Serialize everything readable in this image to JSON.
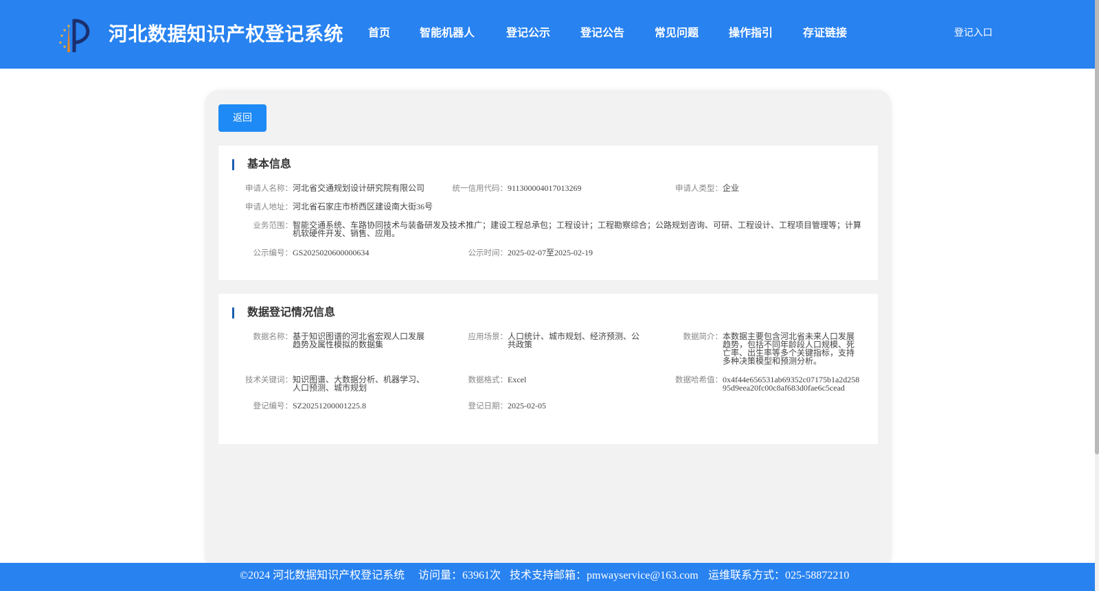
{
  "header": {
    "title": "河北数据知识产权登记系统",
    "nav": [
      "首页",
      "智能机器人",
      "登记公示",
      "登记公告",
      "常见问题",
      "操作指引",
      "存证链接"
    ],
    "login": "登记入口"
  },
  "back_label": "返回",
  "basic": {
    "title": "基本信息",
    "applicant_name": {
      "label": "申请人名称：",
      "value": "河北省交通规划设计研究院有限公司"
    },
    "credit_code": {
      "label": "统一信用代码：",
      "value": "911300004017013269"
    },
    "applicant_type": {
      "label": "申请人类型：",
      "value": "企业"
    },
    "address": {
      "label": "申请人地址：",
      "value": "河北省石家庄市桥西区建设南大街36号"
    },
    "scope": {
      "label": "业务范围：",
      "value": "智能交通系统、车路协同技术与装备研发及技术推广；建设工程总承包；工程设计；工程勘察综合；公路规划咨询、可研、工程设计、工程项目管理等；计算机软硬件开发、销售、应用。"
    },
    "notice_no": {
      "label": "公示编号：",
      "value": "GS2025020600000634"
    },
    "notice_time": {
      "label": "公示时间：",
      "value": "2025-02-07至2025-02-19"
    }
  },
  "data": {
    "title": "数据登记情况信息",
    "name": {
      "label": "数据名称：",
      "value": "基于知识图谱的河北省宏观人口发展趋势及属性模拟的数据集"
    },
    "scenario": {
      "label": "应用场景：",
      "value": "人口统计、城市规划、经济预测、公共政策"
    },
    "intro": {
      "label": "数据简介：",
      "value": "本数据主要包含河北省未来人口发展趋势，包括不同年龄段人口规模、死亡率、出生率等多个关键指标，支持多种决策模型和预测分析。"
    },
    "keywords": {
      "label": "技术关键词：",
      "value": "知识图谱、大数据分析、机器学习、人口预测、城市规划"
    },
    "format": {
      "label": "数据格式：",
      "value": "Excel"
    },
    "hash": {
      "label": "数据哈希值：",
      "value": "0x4f44e656531ab69352c07175b1a2d25895d9eea20fc00c8af683d0fae6c5cead"
    },
    "reg_no": {
      "label": "登记编号：",
      "value": "SZ20251200001225.8"
    },
    "reg_date": {
      "label": "登记日期：",
      "value": "2025-02-05"
    }
  },
  "footer": {
    "copyright": "©2024 河北数据知识产权登记系统",
    "visits": "访问量：63961次",
    "email": "技术支持邮箱：pmwayservice@163.com",
    "phone": "运维联系方式：025-58872210"
  }
}
